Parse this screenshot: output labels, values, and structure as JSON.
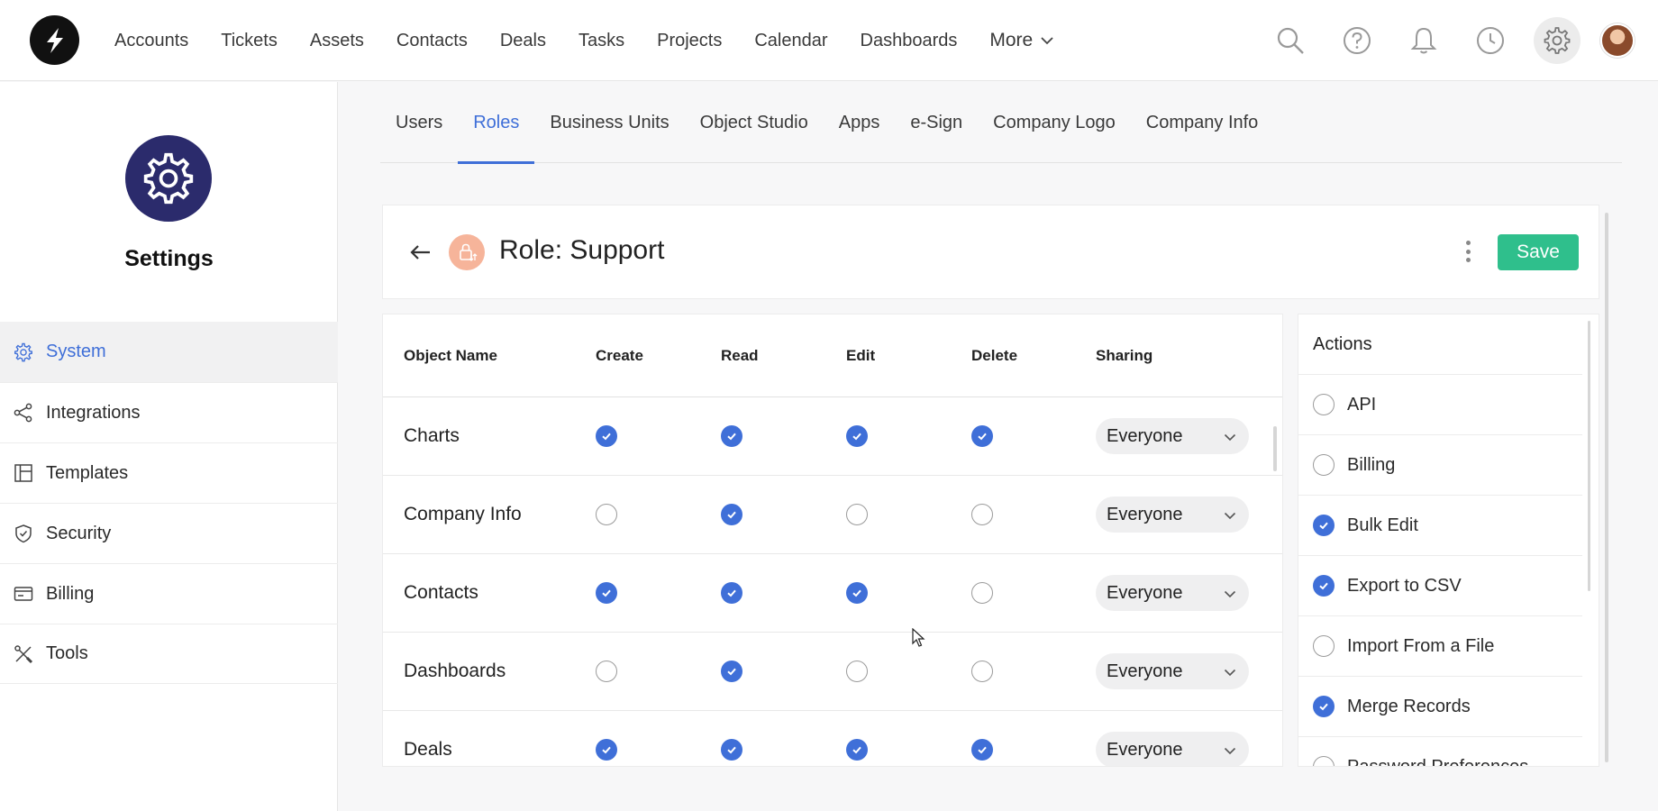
{
  "nav": {
    "items": [
      "Accounts",
      "Tickets",
      "Assets",
      "Contacts",
      "Deals",
      "Tasks",
      "Projects",
      "Calendar",
      "Dashboards"
    ],
    "more_label": "More"
  },
  "sidebar": {
    "title": "Settings",
    "items": [
      {
        "label": "System",
        "icon": "gear-icon",
        "active": true
      },
      {
        "label": "Integrations",
        "icon": "share-icon"
      },
      {
        "label": "Templates",
        "icon": "layout-icon"
      },
      {
        "label": "Security",
        "icon": "shield-icon"
      },
      {
        "label": "Billing",
        "icon": "card-icon"
      },
      {
        "label": "Tools",
        "icon": "tools-icon"
      }
    ]
  },
  "tabs": [
    "Users",
    "Roles",
    "Business Units",
    "Object Studio",
    "Apps",
    "e-Sign",
    "Company Logo",
    "Company Info"
  ],
  "active_tab": "Roles",
  "role": {
    "title": "Role: Support",
    "save_label": "Save"
  },
  "permissions": {
    "headers": {
      "name": "Object Name",
      "create": "Create",
      "read": "Read",
      "edit": "Edit",
      "delete": "Delete",
      "sharing": "Sharing"
    },
    "rows": [
      {
        "name": "Charts",
        "create": true,
        "read": true,
        "edit": true,
        "delete": true,
        "sharing": "Everyone"
      },
      {
        "name": "Company Info",
        "create": false,
        "read": true,
        "edit": false,
        "delete": false,
        "sharing": "Everyone"
      },
      {
        "name": "Contacts",
        "create": true,
        "read": true,
        "edit": true,
        "delete": false,
        "sharing": "Everyone"
      },
      {
        "name": "Dashboards",
        "create": false,
        "read": true,
        "edit": false,
        "delete": false,
        "sharing": "Everyone"
      },
      {
        "name": "Deals",
        "create": true,
        "read": true,
        "edit": true,
        "delete": true,
        "sharing": "Everyone"
      }
    ]
  },
  "actions": {
    "title": "Actions",
    "items": [
      {
        "label": "API",
        "checked": false
      },
      {
        "label": "Billing",
        "checked": false
      },
      {
        "label": "Bulk Edit",
        "checked": true
      },
      {
        "label": "Export to CSV",
        "checked": true
      },
      {
        "label": "Import From a File",
        "checked": false
      },
      {
        "label": "Merge Records",
        "checked": true
      },
      {
        "label": "Password Preferences",
        "checked": false
      }
    ]
  },
  "colors": {
    "accent": "#3f6fd8",
    "save": "#2fbf8c",
    "settings_badge": "#2b2b6c",
    "role_icon": "#f6b49a"
  }
}
